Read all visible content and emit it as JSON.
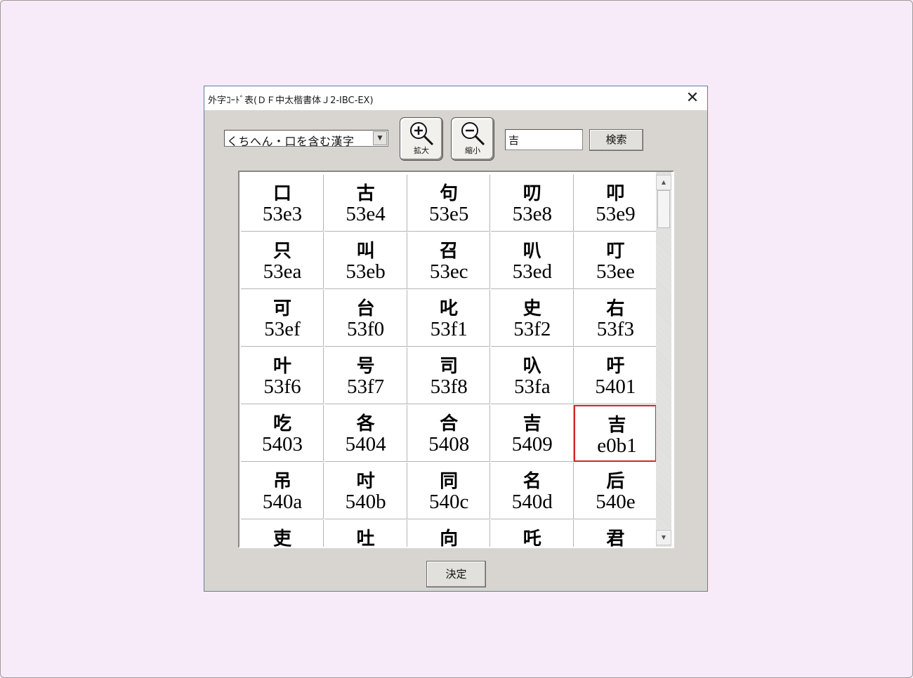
{
  "window": {
    "title": "外字ｺｰﾄﾞ表(ＤＦ中太楷書体Ｊ2-IBC-EX)",
    "close_glyph": "✕"
  },
  "toolbar": {
    "category_select": "くちへん・口を含む漢字",
    "zoom_in_label": "拡大",
    "zoom_in_icon": "zoom-in-icon",
    "zoom_out_label": "縮小",
    "zoom_out_icon": "zoom-out-icon",
    "search_value": "吉",
    "search_button_label": "検索"
  },
  "grid": {
    "selected_code": "e0b1",
    "cells": [
      {
        "glyph": "口",
        "code": "53e3"
      },
      {
        "glyph": "古",
        "code": "53e4"
      },
      {
        "glyph": "句",
        "code": "53e5"
      },
      {
        "glyph": "叨",
        "code": "53e8"
      },
      {
        "glyph": "叩",
        "code": "53e9"
      },
      {
        "glyph": "只",
        "code": "53ea"
      },
      {
        "glyph": "叫",
        "code": "53eb"
      },
      {
        "glyph": "召",
        "code": "53ec"
      },
      {
        "glyph": "叭",
        "code": "53ed"
      },
      {
        "glyph": "叮",
        "code": "53ee"
      },
      {
        "glyph": "可",
        "code": "53ef"
      },
      {
        "glyph": "台",
        "code": "53f0"
      },
      {
        "glyph": "叱",
        "code": "53f1"
      },
      {
        "glyph": "史",
        "code": "53f2"
      },
      {
        "glyph": "右",
        "code": "53f3"
      },
      {
        "glyph": "叶",
        "code": "53f6"
      },
      {
        "glyph": "号",
        "code": "53f7"
      },
      {
        "glyph": "司",
        "code": "53f8"
      },
      {
        "glyph": "叺",
        "code": "53fa"
      },
      {
        "glyph": "吁",
        "code": "5401"
      },
      {
        "glyph": "吃",
        "code": "5403"
      },
      {
        "glyph": "各",
        "code": "5404"
      },
      {
        "glyph": "合",
        "code": "5408"
      },
      {
        "glyph": "吉",
        "code": "5409"
      },
      {
        "glyph": "吉",
        "code": "e0b1"
      },
      {
        "glyph": "吊",
        "code": "540a"
      },
      {
        "glyph": "吋",
        "code": "540b"
      },
      {
        "glyph": "同",
        "code": "540c"
      },
      {
        "glyph": "名",
        "code": "540d"
      },
      {
        "glyph": "后",
        "code": "540e"
      },
      {
        "glyph": "吏",
        "code": ""
      },
      {
        "glyph": "吐",
        "code": ""
      },
      {
        "glyph": "向",
        "code": ""
      },
      {
        "glyph": "吒",
        "code": ""
      },
      {
        "glyph": "君",
        "code": ""
      }
    ]
  },
  "footer": {
    "ok_button_label": "決定"
  },
  "scrollbar": {
    "up_arrow": "▲",
    "down_arrow": "▼"
  },
  "colors": {
    "dialog_bg": "#d8d5d0",
    "selection_border": "#d02828",
    "page_bg": "#f8ebf9"
  }
}
